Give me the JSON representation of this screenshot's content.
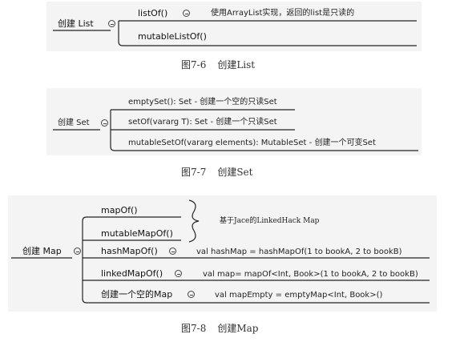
{
  "fig1": {
    "root": "创建 List",
    "items": [
      {
        "label": "listOf()",
        "note": "使用ArrayList实现，返回的list是只读的"
      },
      {
        "label": "mutableListOf()"
      }
    ],
    "caption_num": "图7-6",
    "caption_text": "创建List"
  },
  "fig2": {
    "root": "创建 Set",
    "items": [
      {
        "label": "emptySet(): Set - 创建一个空的只读Set"
      },
      {
        "label": "setOf(vararg T): Set - 创建一个只读Set"
      },
      {
        "label": "mutableSetOf(vararg elements): MutableSet - 创建一个可变Set"
      }
    ],
    "caption_num": "图7-7",
    "caption_text": "创建Set"
  },
  "fig3": {
    "root": "创建 Map",
    "items": [
      {
        "label": "mapOf()"
      },
      {
        "label": "mutableMapOf()"
      },
      {
        "label": "hashMapOf()",
        "note": "val hashMap = hashMapOf(1 to bookA, 2 to bookB)"
      },
      {
        "label": "linkedMapOf()",
        "note": "val map= mapOf<Int, Book>(1 to bookA, 2 to bookB)"
      },
      {
        "label": "创建一个空的Map",
        "note": "val mapEmpty = emptyMap<Int, Book>()"
      }
    ],
    "brace_note": "基于Jace的LinkedHack Map",
    "caption_num": "图7-8",
    "caption_text": "创建Map"
  },
  "icons": {
    "collapse": "minus-circle-icon",
    "brace": "curly-brace-icon"
  }
}
